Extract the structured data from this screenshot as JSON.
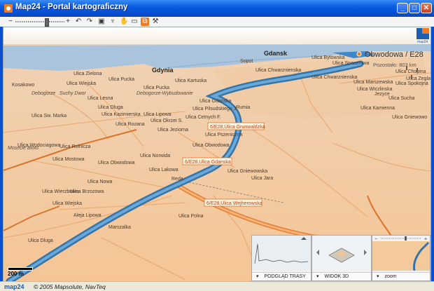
{
  "window": {
    "title": "Map24 - Portal kartograficzny",
    "minimize": "_",
    "maximize": "□",
    "close": "✕"
  },
  "toolbar": {
    "zoom_out": "−",
    "zoom_in": "+",
    "tools": [
      "back-icon",
      "forward-icon",
      "print-icon",
      "pin-icon",
      "hand-icon",
      "measure-icon",
      "route-3d-icon",
      "settings-icon"
    ]
  },
  "map": {
    "cities": [
      "Gdansk",
      "Gdynia",
      "Sopot",
      "Reda",
      "Rumia"
    ],
    "route_top_label": "Obwodowa / E28",
    "route_top_sub": "Pozostało: 803 km",
    "route_labels": [
      "6/E28,Ulica Grunwaldzka",
      "6/E28,Ulica Gdanska",
      "6/E28,Ulica Wejherowska"
    ],
    "streets": [
      "Ulica Bytowska",
      "Ulica Spacerowa",
      "Ulica Chwarznienska",
      "Ulica Chwarznienska",
      "Ulica Marszewska",
      "Ulica Zielona",
      "Ulica Wiejska",
      "Ulica Pucka",
      "Ulica Pucka",
      "Ulica Kartuska",
      "Ulica Lesna",
      "Ulica Dluga",
      "Ulica Gdanska",
      "Ulica Pilsudskiego J.",
      "Ulica Kazimierska",
      "Ulica Lipowa",
      "Ulica Okrzei S.",
      "Ulica Cetnych F.",
      "Ulica Rozana",
      "Ulica Jeziorna",
      "Ulica Pszeniczna",
      "Ulica Obwodowa",
      "Ulica Norwida",
      "Ulica Wodociagowa",
      "Ulica Mostowa",
      "Ulica Rolnicza",
      "Ulica Obwodowa",
      "Ulica Lakowa",
      "Ulica Nowa",
      "Ulica Brzozowa",
      "Ulica Wierzbowa",
      "Ulica Wiejska",
      "Aleja Lipowa",
      "Ulica Dluga",
      "Ulica Polna",
      "Marszalka",
      "Ulica Gniewowska",
      "Ulica Jara",
      "Ulica Kamienna",
      "Ulica Sucha",
      "Ulica Chopina",
      "Ulica Wiczlinska",
      "Ulica Gniewowo",
      "Ulica Sw. Marka",
      "Ulica Spokojna",
      "Ulica Zeglar"
    ],
    "places": [
      "Kosakowo",
      "Debogorze",
      "Suchy Dwor",
      "Debogorze-Wybudowanie",
      "Mosecie Bloto",
      "Jezyce"
    ],
    "scale": "200 m"
  },
  "panels": {
    "profile": "PODGLĄD TRASY",
    "view3d": "WIDOK 3D",
    "zoom": "zoom"
  },
  "status": {
    "logo": "map24",
    "copyright": "© 2005 Mapsolute, NavTeq"
  },
  "colors": {
    "land": "#f4c99c",
    "water": "#a7c2da",
    "route": "#3d7fb6",
    "accent": "#f07a1d"
  }
}
